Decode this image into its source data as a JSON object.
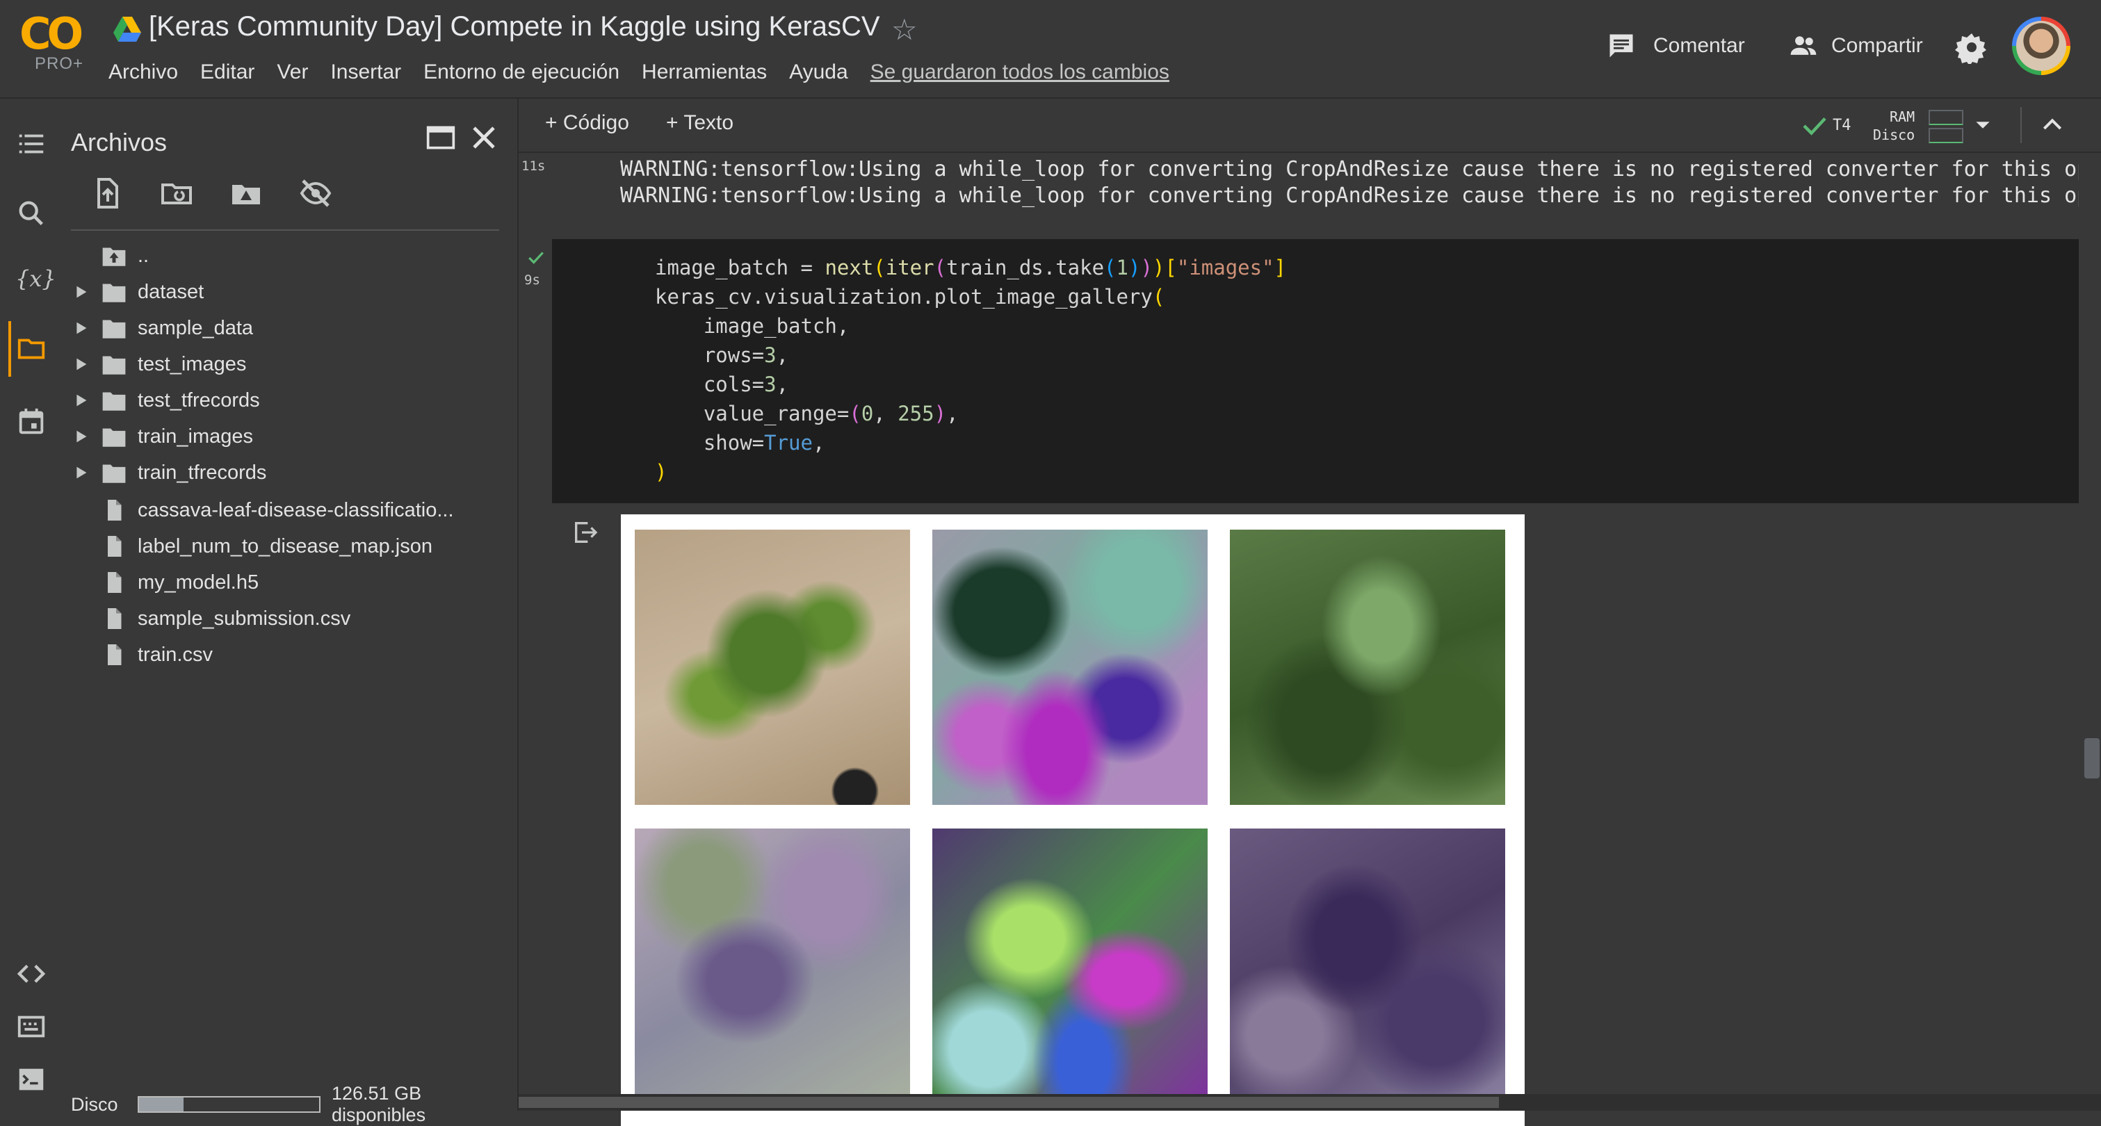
{
  "app": {
    "logo_text": "CO",
    "logo_badge": "PRO+",
    "title": "[Keras Community Day] Compete in Kaggle using KerasCV",
    "colors": {
      "brand": "#f9ab00",
      "background": "#383838",
      "code_background": "#1e1e1e",
      "accent": "#f29900"
    }
  },
  "menu": {
    "items": [
      "Archivo",
      "Editar",
      "Ver",
      "Insertar",
      "Entorno de ejecución",
      "Herramientas",
      "Ayuda"
    ],
    "saved_status": "Se guardaron todos los cambios"
  },
  "header_actions": {
    "comment_label": "Comentar",
    "share_label": "Compartir",
    "icons": [
      "comment-icon",
      "share-people-icon",
      "gear-icon",
      "avatar"
    ]
  },
  "files_panel": {
    "title": "Archivos",
    "toolbar_icons": [
      "upload-file-icon",
      "refresh-folder-icon",
      "mount-drive-icon",
      "hide-files-icon"
    ],
    "parent_label": "..",
    "folders": [
      "dataset",
      "sample_data",
      "test_images",
      "test_tfrecords",
      "train_images",
      "train_tfrecords"
    ],
    "files": [
      "cassava-leaf-disease-classificatio...",
      "label_num_to_disease_map.json",
      "my_model.h5",
      "sample_submission.csv",
      "train.csv"
    ],
    "disk_label": "Disco",
    "disk_available": "126.51 GB disponibles",
    "disk_used_fraction": 0.25
  },
  "toolbar": {
    "add_code": "+ Código",
    "add_text": "+ Texto",
    "runtime_type": "T4",
    "ram_label": "RAM",
    "disk_label": "Disco"
  },
  "cells": {
    "prev_exec_time": "11s",
    "prev_output": [
      "WARNING:tensorflow:Using a while_loop for converting CropAndResize cause there is no registered converter for this op.",
      "WARNING:tensorflow:Using a while_loop for converting CropAndResize cause there is no registered converter for this op."
    ],
    "exec_time": "9s",
    "code": {
      "l1_a": "image_batch = ",
      "l1_fn1": "next",
      "l1_fn2": "iter",
      "l1_b": "train_ds.take",
      "l1_num": "1",
      "l1_str": "\"images\"",
      "l2_a": "keras_cv.visualization.plot_image_gallery",
      "l3": "    image_batch,",
      "l4_a": "    rows=",
      "l4_num": "3",
      "l5_a": "    cols=",
      "l5_num": "3",
      "l6_a": "    value_range=",
      "l6_n1": "0",
      "l6_n2": "255",
      "l7_a": "    show=",
      "l7_kw": "True",
      "l8": ")"
    },
    "gallery": {
      "rows": 3,
      "cols": 3,
      "visible_images": [
        "cassava-plant-image",
        "cassava-inverted-colors-image",
        "cassava-leaves-image",
        "cassava-purple-leaves-image",
        "cassava-inverted-leaves-image",
        "cassava-dark-leaves-image"
      ]
    }
  }
}
